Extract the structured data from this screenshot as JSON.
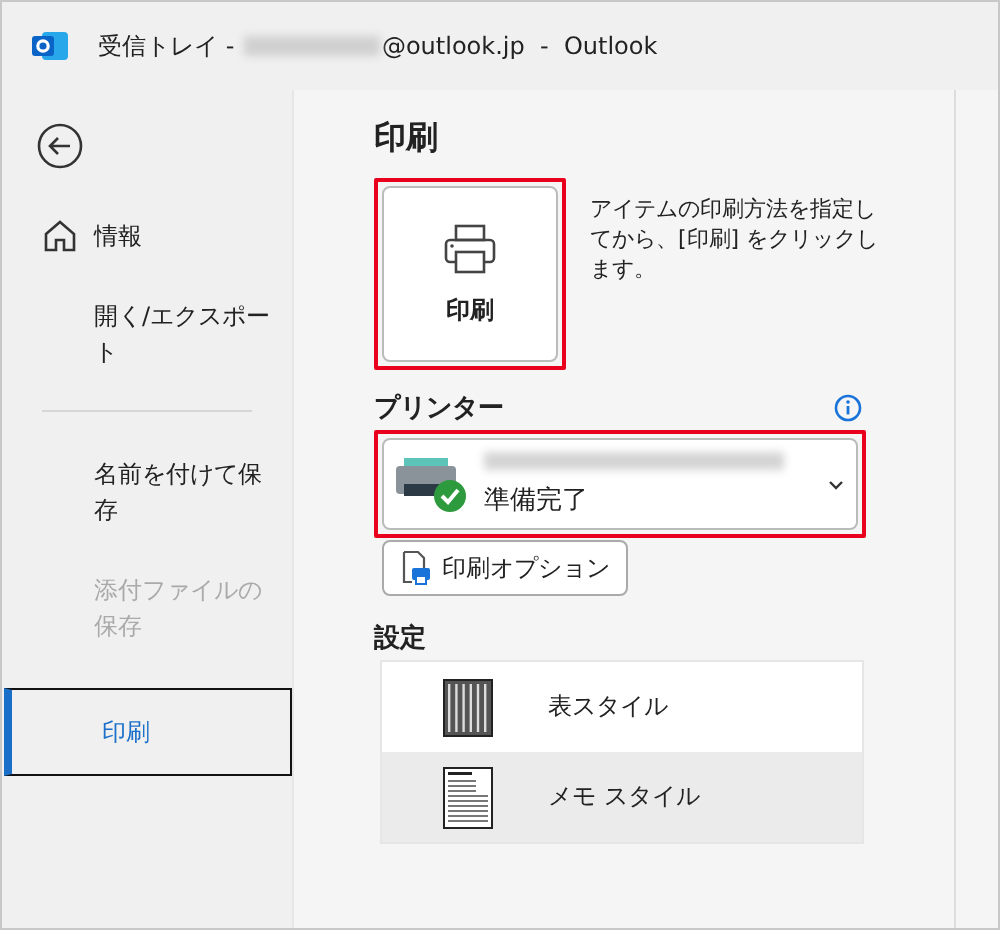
{
  "window": {
    "title_prefix": "受信トレイ - ",
    "title_suffix": "@outlook.jp  -  Outlook"
  },
  "sidebar": {
    "items": [
      {
        "label": "情報",
        "kind": "home",
        "disabled": false,
        "selected": false
      },
      {
        "label": "開く/エクスポート",
        "kind": "plain",
        "disabled": false,
        "selected": false
      },
      {
        "kind": "divider"
      },
      {
        "label": "名前を付けて保存",
        "kind": "plain",
        "disabled": false,
        "selected": false
      },
      {
        "label": "添付ファイルの保存",
        "kind": "plain",
        "disabled": true,
        "selected": false
      },
      {
        "label": "印刷",
        "kind": "plain",
        "disabled": false,
        "selected": true
      }
    ]
  },
  "main": {
    "heading": "印刷",
    "print_button": {
      "label": "印刷",
      "highlighted": true
    },
    "description": "アイテムの印刷方法を指定してから、[印刷] をクリックします。",
    "printer": {
      "label": "プリンター",
      "status": "準備完了",
      "highlighted": true
    },
    "print_options_button": "印刷オプション",
    "settings": {
      "label": "設定",
      "styles": [
        {
          "label": "表スタイル",
          "kind": "table",
          "selected": false
        },
        {
          "label": "メモ スタイル",
          "kind": "memo",
          "selected": true
        }
      ]
    }
  }
}
